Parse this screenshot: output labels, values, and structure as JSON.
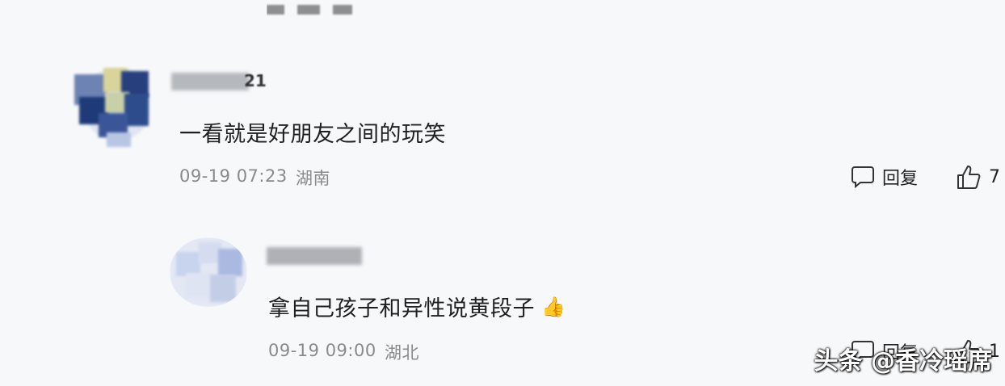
{
  "comments": [
    {
      "user_suffix": "21",
      "text": "一看就是好朋友之间的玩笑",
      "date": "09-19 07:23",
      "location": "湖南",
      "reply_label": "回复",
      "likes": "7",
      "reply_icon": "comment-bubble-icon",
      "like_icon": "thumbs-up-icon"
    },
    {
      "text": "拿自己孩子和异性说黄段子",
      "emoji": "👍",
      "date": "09-19 09:00",
      "location": "湖北",
      "reply_label": "回复",
      "likes": "1",
      "reply_icon": "comment-bubble-icon",
      "like_icon": "thumbs-up-icon"
    }
  ],
  "watermark": "头条 @香冷瑶席"
}
